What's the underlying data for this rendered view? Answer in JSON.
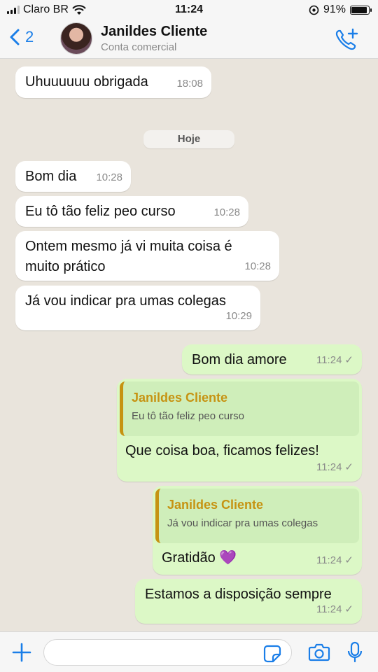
{
  "status_bar": {
    "carrier": "Claro BR",
    "time": "11:24",
    "battery_percent": "91%",
    "battery_level": 0.91
  },
  "header": {
    "back_count": "2",
    "contact_name": "Janildes Cliente",
    "contact_subtitle": "Conta comercial",
    "icons": [
      "back-chevron-icon",
      "avatar",
      "add-call-icon"
    ]
  },
  "messages": [
    {
      "dir": "in",
      "text": "Uhuuuuuu obrigada",
      "time": "18:08"
    },
    {
      "type": "date",
      "text": "Hoje"
    },
    {
      "dir": "in",
      "text": "Bom dia",
      "time": "10:28"
    },
    {
      "dir": "in",
      "text": "Eu tô tão feliz peo curso",
      "time": "10:28"
    },
    {
      "dir": "in",
      "text": "Ontem mesmo já vi muita coisa é muito prático",
      "time": "10:28"
    },
    {
      "dir": "in",
      "text": "Já vou indicar pra umas colegas",
      "time": "10:29"
    },
    {
      "dir": "out",
      "text": "Bom dia amore",
      "time": "11:24",
      "status": "✓"
    },
    {
      "dir": "out",
      "quote_name": "Janildes Cliente",
      "quote_text": "Eu tô tão feliz peo curso",
      "text": "Que coisa boa, ficamos felizes!",
      "time": "11:24",
      "status": "✓"
    },
    {
      "dir": "out",
      "quote_name": "Janildes Cliente",
      "quote_text": "Já vou indicar pra umas colegas",
      "text": "Gratidão 💜",
      "time": "11:24",
      "status": "✓"
    },
    {
      "dir": "out",
      "text": "Estamos a disposição sempre",
      "time": "11:24",
      "status": "✓"
    }
  ],
  "input_bar": {
    "placeholder": "",
    "icons": [
      "plus-icon",
      "sticker-icon",
      "camera-icon",
      "microphone-icon"
    ]
  },
  "colors": {
    "incoming_bubble": "#ffffff",
    "outgoing_bubble": "#dcf8c6",
    "accent_blue": "#1a7ee8",
    "quote_accent": "#c69312",
    "chat_background": "#e9e4dc"
  }
}
